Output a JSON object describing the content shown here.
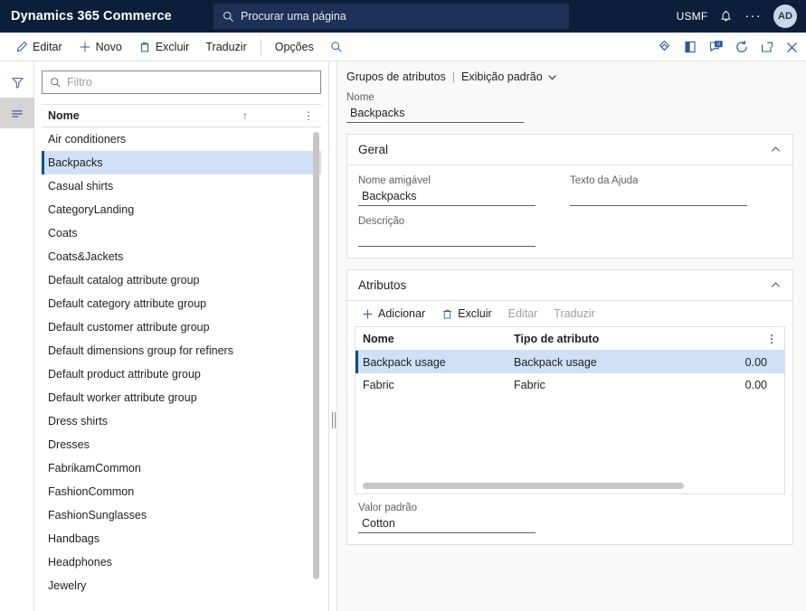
{
  "topbar": {
    "brand": "Dynamics 365 Commerce",
    "search_placeholder": "Procurar uma página",
    "search_icon": "search-icon",
    "company": "USMF",
    "bell_icon": "notification-bell-icon",
    "ellipsis": "···",
    "avatar_initials": "AD"
  },
  "commandbar": {
    "edit_label": "Editar",
    "new_label": "Novo",
    "delete_label": "Excluir",
    "translate_label": "Traduzir",
    "options_label": "Opções",
    "search_icon": "search-icon",
    "right_icons": [
      {
        "name": "attachments-icon"
      },
      {
        "name": "office-apps-icon"
      },
      {
        "name": "messages-badge-icon",
        "badge": "0"
      },
      {
        "name": "refresh-icon"
      },
      {
        "name": "popout-icon"
      },
      {
        "name": "close-icon"
      }
    ]
  },
  "rail": {
    "filter_icon": "filter-funnel-icon",
    "list_icon": "list-lines-icon"
  },
  "listpane": {
    "filter_placeholder": "Filtro",
    "filter_icon": "search-icon",
    "column_header": "Nome",
    "sort_indicator": "↑",
    "overflow_icon": "column-options-icon",
    "selected": "Backpacks",
    "items": [
      "Air conditioners",
      "Backpacks",
      "Casual shirts",
      "CategoryLanding",
      "Coats",
      "Coats&Jackets",
      "Default catalog attribute group",
      "Default category attribute group",
      "Default customer attribute group",
      "Default dimensions group for refiners",
      "Default product attribute group",
      "Default worker attribute group",
      "Dress shirts",
      "Dresses",
      "FabrikamCommon",
      "FashionCommon",
      "FashionSunglasses",
      "Handbags",
      "Headphones",
      "Jewelry"
    ]
  },
  "detail": {
    "breadcrumb_page": "Grupos de atributos",
    "breadcrumb_separator": "|",
    "breadcrumb_view": "Exibição padrão",
    "name_label": "Nome",
    "name_value": "Backpacks",
    "general": {
      "title": "Geral",
      "friendly_name_label": "Nome amigável",
      "friendly_name_value": "Backpacks",
      "help_text_label": "Texto da Ajuda",
      "help_text_value": "",
      "description_label": "Descrição",
      "description_value": ""
    },
    "attributes": {
      "title": "Atributos",
      "toolbar": {
        "add_label": "Adicionar",
        "delete_label": "Excluir",
        "edit_label": "Editar",
        "translate_label": "Traduzir"
      },
      "columns": [
        "Nome",
        "Tipo de atributo",
        ""
      ],
      "rows": [
        {
          "name": "Backpack usage",
          "type": "Backpack usage",
          "value": "0.00",
          "selected": true
        },
        {
          "name": "Fabric",
          "type": "Fabric",
          "value": "0.00",
          "selected": false
        }
      ],
      "default_value_label": "Valor padrão",
      "default_value": "Cotton"
    }
  },
  "colors": {
    "navy": "#0b1f3a",
    "accent_blue": "#2b579a",
    "selection_blue": "#cfe0f7",
    "selection_bar": "#0f4d92"
  }
}
